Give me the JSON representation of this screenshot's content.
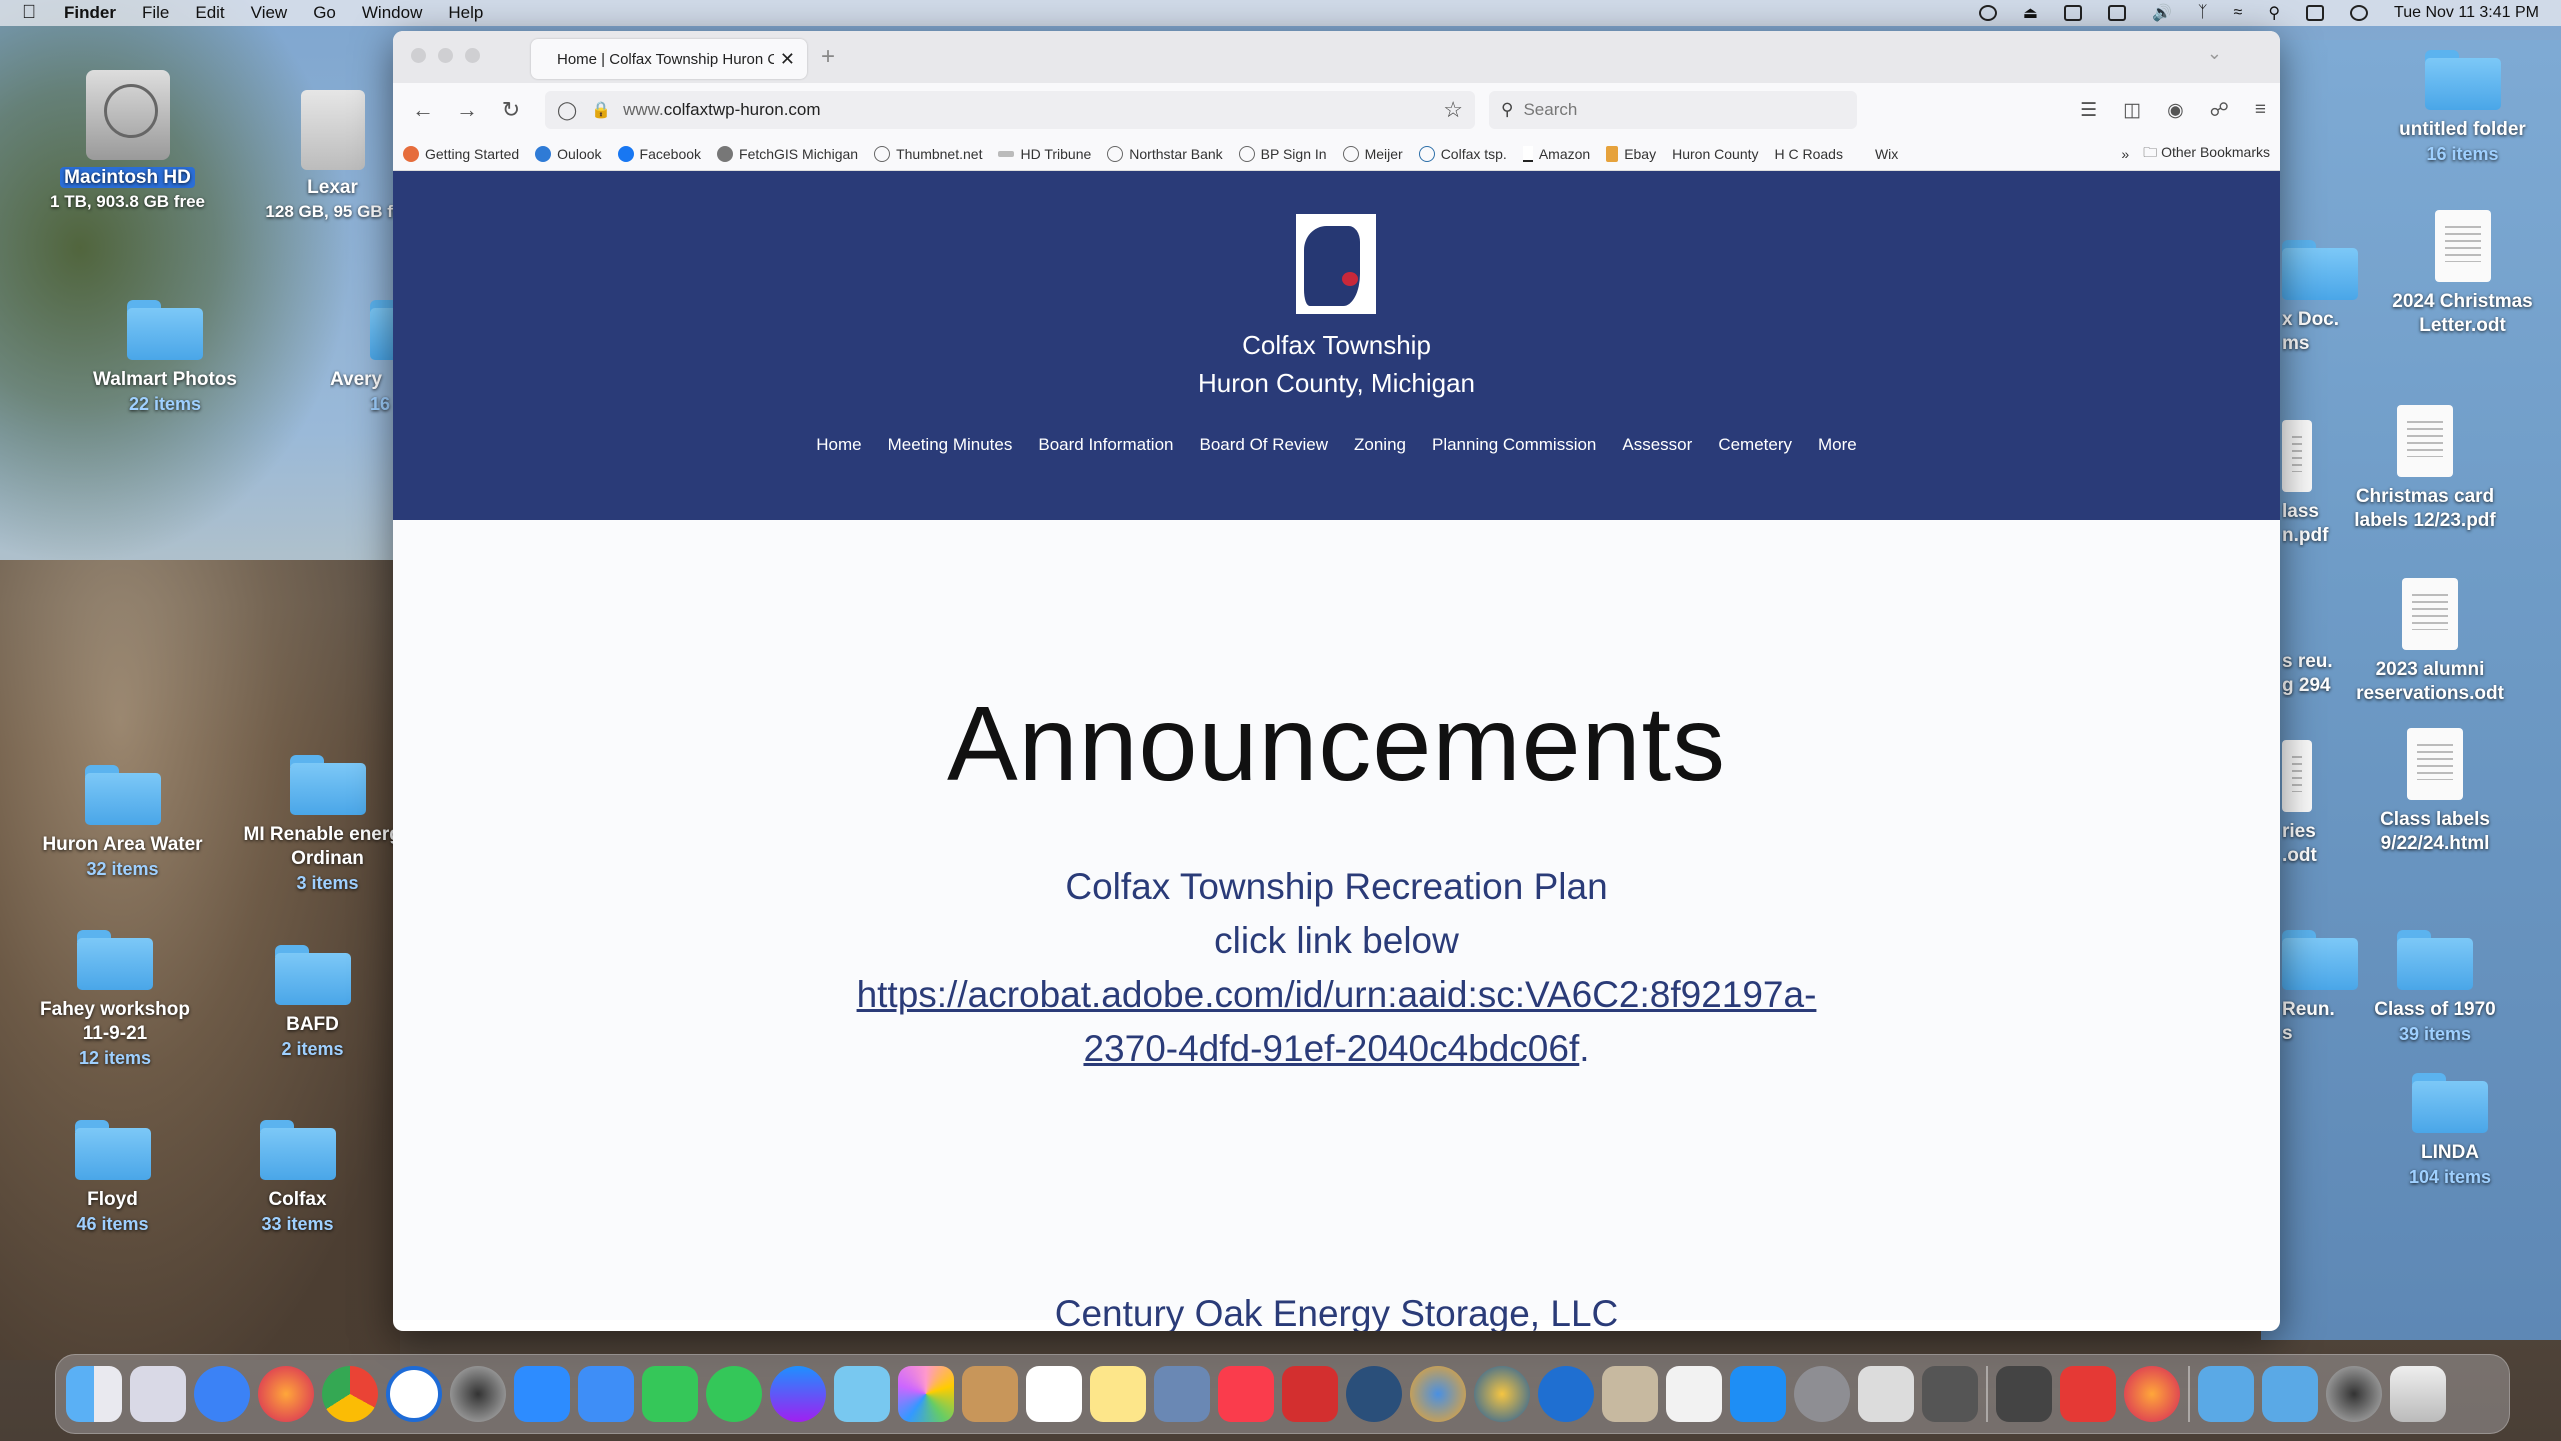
{
  "menubar": {
    "app": "Finder",
    "items": [
      "File",
      "Edit",
      "View",
      "Go",
      "Window",
      "Help"
    ],
    "datetime": "Tue Nov 11  3:41 PM"
  },
  "desktop": {
    "left_icons": [
      {
        "name": "Macintosh HD",
        "sub": "1 TB, 903.8 GB free",
        "kind": "hdd"
      },
      {
        "name": "Lexar",
        "sub": "128 GB, 95 GB fr",
        "kind": "lexar"
      },
      {
        "name": "Walmart Photos",
        "sub": "22 items",
        "kind": "folder"
      },
      {
        "name": "Avery",
        "sub": "16",
        "kind": "folder"
      },
      {
        "name": "Huron Area Water",
        "sub": "32 items",
        "kind": "folder"
      },
      {
        "name": "MI Renable energy Ordinan",
        "sub": "3 items",
        "kind": "folder"
      },
      {
        "name": "Fahey workshop 11-9-21",
        "sub": "12 items",
        "kind": "folder"
      },
      {
        "name": "BAFD",
        "sub": "2 items",
        "kind": "folder"
      },
      {
        "name": "Floyd",
        "sub": "46 items",
        "kind": "folder"
      },
      {
        "name": "Colfax",
        "sub": "33 items",
        "kind": "folder"
      }
    ],
    "right_icons": [
      {
        "name": "untitled folder",
        "sub": "16 items",
        "kind": "folder"
      },
      {
        "name": "2024 Christmas Letter.odt",
        "sub": "",
        "kind": "doc"
      },
      {
        "name": "Christmas card labels 12/23.pdf",
        "sub": "",
        "kind": "doc"
      },
      {
        "name": "2023 alumni reservations.odt",
        "sub": "",
        "kind": "doc"
      },
      {
        "name": "Class labels 9/22/24.html",
        "sub": "",
        "kind": "doc"
      },
      {
        "name": "Class of 1970",
        "sub": "39 items",
        "kind": "folder"
      },
      {
        "name": "LINDA",
        "sub": "104 items",
        "kind": "folder"
      }
    ],
    "partial_icons": [
      {
        "name": "x Doc.",
        "sub": "ms"
      },
      {
        "name": "lass",
        "sub": "n.pdf"
      },
      {
        "name": "s reu.",
        "sub": "g 294"
      },
      {
        "name": "ries",
        "sub": ".odt"
      },
      {
        "name": "Reun.",
        "sub": "s"
      }
    ]
  },
  "browser": {
    "tab_title": "Home | Colfax Township Huron C",
    "url_prefix": "www.",
    "url_domain": "colfaxtwp-huron.com",
    "search_placeholder": "Search",
    "bookmarks": [
      "Getting Started",
      "Oulook",
      "Facebook",
      "FetchGIS Michigan",
      "Thumbnet.net",
      "HD Tribune",
      "Northstar Bank",
      "BP Sign In",
      "Meijer",
      "Colfax tsp.",
      "Amazon",
      "Ebay",
      "Huron County",
      "H C Roads",
      "Wix"
    ],
    "other_bookmarks": "Other Bookmarks"
  },
  "site": {
    "title_line1": "Colfax Township",
    "title_line2": "Huron County, Michigan",
    "nav": [
      "Home",
      "Meeting Minutes",
      "Board Information",
      "Board Of Review",
      "Zoning",
      "Planning Commission",
      "Assessor",
      "Cemetery",
      "More"
    ],
    "heading": "Announcements",
    "rec_title": "Colfax Township Recreation Plan",
    "rec_sub": "click link below",
    "rec_link": "https://acrobat.adobe.com/id/urn:aaid:sc:VA6C2:8f92197a-2370-4dfd-91ef-2040c4bdc06f",
    "rec_link_trail": ".",
    "next_title": "Century Oak Energy Storage, LLC",
    "header_color": "#2a3b78"
  }
}
